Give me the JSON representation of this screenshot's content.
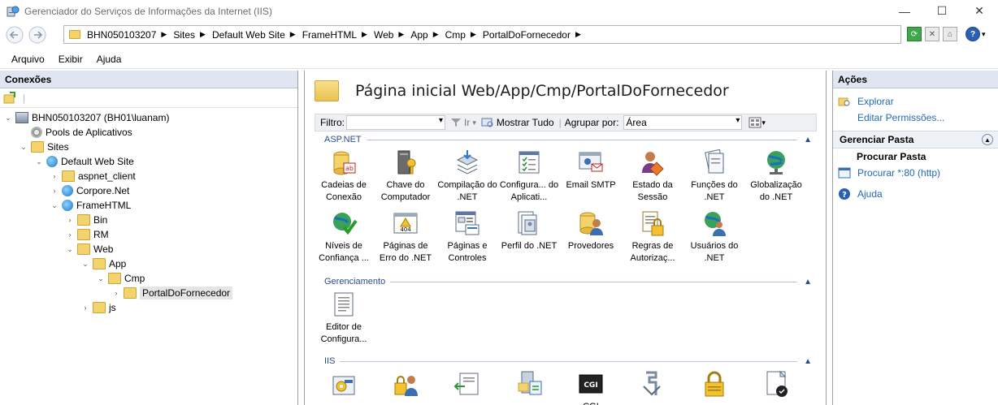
{
  "window": {
    "title": "Gerenciador do Serviços de Informações da Internet (IIS)",
    "minimize": "—",
    "maximize": "☐",
    "close": "✕"
  },
  "address": {
    "crumbs": [
      "BHN050103207",
      "Sites",
      "Default Web Site",
      "FrameHTML",
      "Web",
      "App",
      "Cmp",
      "PortalDoFornecedor"
    ]
  },
  "menu": {
    "items": [
      "Arquivo",
      "Exibir",
      "Ajuda"
    ]
  },
  "connections": {
    "header": "Conexões",
    "tree": [
      {
        "label": "BHN050103207 (BH01\\luanam)",
        "depth": 0,
        "exp": "⌄",
        "icon": "server-icon"
      },
      {
        "label": "Pools de Aplicativos",
        "depth": 1,
        "exp": "",
        "icon": "app-pool-icon"
      },
      {
        "label": "Sites",
        "depth": 1,
        "exp": "⌄",
        "icon": "sites-folder-icon"
      },
      {
        "label": "Default Web Site",
        "depth": 2,
        "exp": "⌄",
        "icon": "website-globe-icon"
      },
      {
        "label": "aspnet_client",
        "depth": 3,
        "exp": "›",
        "icon": "folder-icon"
      },
      {
        "label": "Corpore.Net",
        "depth": 3,
        "exp": "›",
        "icon": "application-icon"
      },
      {
        "label": "FrameHTML",
        "depth": 3,
        "exp": "⌄",
        "icon": "application-icon"
      },
      {
        "label": "Bin",
        "depth": 4,
        "exp": "›",
        "icon": "folder-icon"
      },
      {
        "label": "RM",
        "depth": 4,
        "exp": "›",
        "icon": "folder-icon"
      },
      {
        "label": "Web",
        "depth": 4,
        "exp": "⌄",
        "icon": "folder-icon"
      },
      {
        "label": "App",
        "depth": 5,
        "exp": "⌄",
        "icon": "folder-icon"
      },
      {
        "label": "Cmp",
        "depth": 6,
        "exp": "⌄",
        "icon": "folder-icon"
      },
      {
        "label": "PortalDoFornecedor",
        "depth": 7,
        "exp": "›",
        "icon": "folder-icon",
        "selected": true
      },
      {
        "label": "js",
        "depth": 5,
        "exp": "›",
        "icon": "folder-icon"
      }
    ]
  },
  "center": {
    "title": "Página inicial Web/App/Cmp/PortalDoFornecedor",
    "filter_label": "Filtro:",
    "go_label": "Ir",
    "show_all_label": "Mostrar Tudo",
    "group_by_label": "Agrupar por:",
    "group_by_value": "Área",
    "groups": [
      {
        "name": "ASP.NET",
        "features": [
          {
            "label": "Cadeias de Conexão",
            "icon": "connection-strings-icon"
          },
          {
            "label": "Chave do Computador",
            "icon": "machine-key-icon"
          },
          {
            "label": "Compilação do .NET",
            "icon": "net-compilation-icon"
          },
          {
            "label": "Configura... do Aplicati...",
            "icon": "app-settings-icon"
          },
          {
            "label": "Email SMTP",
            "icon": "smtp-email-icon"
          },
          {
            "label": "Estado da Sessão",
            "icon": "session-state-icon"
          },
          {
            "label": "Funções do .NET",
            "icon": "net-roles-icon"
          },
          {
            "label": "Globalização do .NET",
            "icon": "net-globalization-icon"
          },
          {
            "label": "Níveis de Confiança ...",
            "icon": "trust-levels-icon"
          },
          {
            "label": "Páginas de Erro do .NET",
            "icon": "net-error-pages-icon"
          },
          {
            "label": "Páginas e Controles",
            "icon": "pages-controls-icon"
          },
          {
            "label": "Perfil do .NET",
            "icon": "net-profile-icon"
          },
          {
            "label": "Provedores",
            "icon": "providers-icon"
          },
          {
            "label": "Regras de Autorizaç...",
            "icon": "authorization-rules-icon"
          },
          {
            "label": "Usuários do .NET",
            "icon": "net-users-icon"
          }
        ]
      },
      {
        "name": "Gerenciamento",
        "features": [
          {
            "label": "Editor de Configura...",
            "icon": "configuration-editor-icon"
          }
        ]
      },
      {
        "name": "IIS",
        "features": [
          {
            "label": "",
            "icon": "asp-icon"
          },
          {
            "label": "",
            "icon": "authentication-icon"
          },
          {
            "label": "",
            "icon": "default-document-icon"
          },
          {
            "label": "",
            "icon": "directory-browsing-icon"
          },
          {
            "label": "CGI",
            "icon": "cgi-icon"
          },
          {
            "label": "",
            "icon": "compression-icon"
          },
          {
            "label": "",
            "icon": "ssl-settings-icon"
          },
          {
            "label": "",
            "icon": "handler-mappings-icon"
          }
        ]
      }
    ]
  },
  "actions": {
    "header": "Ações",
    "items": [
      {
        "label": "Explorar",
        "icon": "explore-icon"
      },
      {
        "label": "Editar Permissões...",
        "icon": ""
      }
    ],
    "section": "Gerenciar Pasta",
    "sub": "Procurar Pasta",
    "browse": "Procurar *:80 (http)",
    "help": "Ajuda"
  }
}
